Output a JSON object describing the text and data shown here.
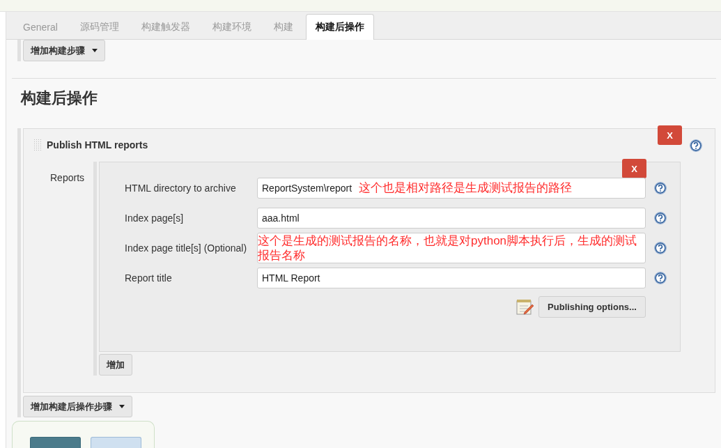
{
  "tabs": [
    {
      "label": "General",
      "selected": false
    },
    {
      "label": "源码管理",
      "selected": false
    },
    {
      "label": "构建触发器",
      "selected": false
    },
    {
      "label": "构建环境",
      "selected": false
    },
    {
      "label": "构建",
      "selected": false
    },
    {
      "label": "构建后操作",
      "selected": true
    }
  ],
  "add_build_step_button": "增加构建步骤",
  "section_title": "构建后操作",
  "publisher": {
    "title": "Publish HTML reports",
    "delete_button": "X",
    "reports_label": "Reports",
    "report": {
      "delete_button": "X",
      "fields": [
        {
          "label": "HTML directory to archive",
          "value": "ReportSystem\\report",
          "annotation": "这个也是相对路径是生成测试报告的路径"
        },
        {
          "label": "Index page[s]",
          "value": "aaa.html"
        },
        {
          "label": "Index page title[s] (Optional)",
          "annotation": "这个是生成的测试报告的名称，也就是对python脚本执行后，生成的测试报告名称"
        },
        {
          "label": "Report title",
          "value": "HTML Report"
        }
      ],
      "publishing_options_button": "Publishing options..."
    },
    "add_button": "增加"
  },
  "add_post_build_step_button": "增加构建后操作步骤"
}
